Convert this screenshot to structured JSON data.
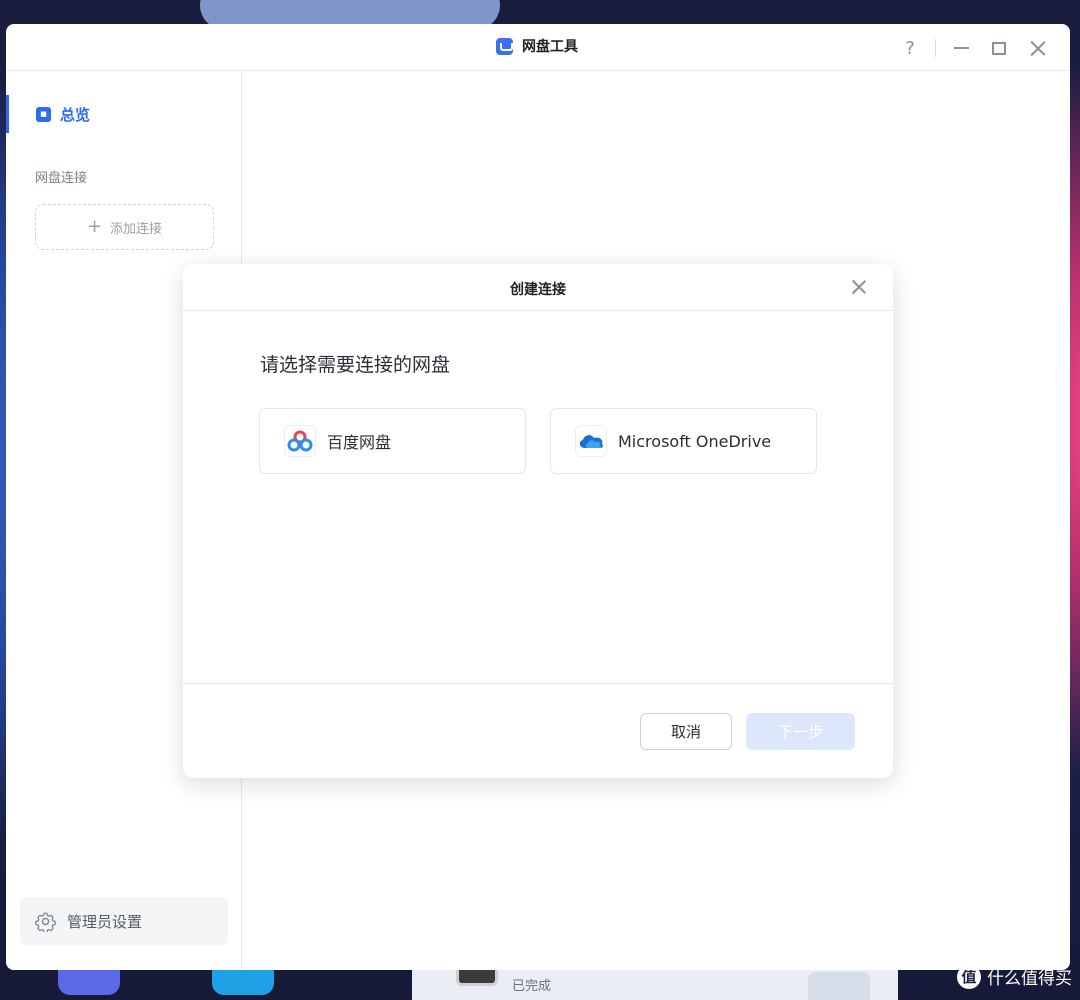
{
  "window": {
    "title": "网盘工具",
    "help_glyph": "?"
  },
  "sidebar": {
    "overview_label": "总览",
    "section_label": "网盘连接",
    "add_connection_label": "添加连接",
    "admin_settings_label": "管理员设置"
  },
  "dialog": {
    "title": "创建连接",
    "prompt": "请选择需要连接的网盘",
    "options": [
      {
        "label": "百度网盘",
        "icon": "baidu-netdisk-icon"
      },
      {
        "label": "Microsoft OneDrive",
        "icon": "onedrive-icon"
      }
    ],
    "cancel_label": "取消",
    "next_label": "下一步"
  },
  "taskbar": {
    "task_status": "已完成"
  },
  "watermark": {
    "text": "什么值得买",
    "logo": "值"
  },
  "colors": {
    "accent": "#2d6bf5",
    "next_disabled_bg": "#dde7fc"
  }
}
